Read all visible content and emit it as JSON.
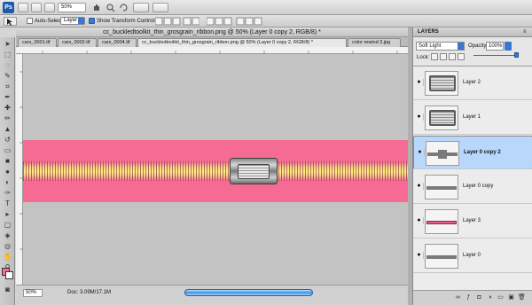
{
  "appbar": {
    "logo": "Ps",
    "zoom": "50%"
  },
  "options": {
    "auto_select_label": "Auto-Select:",
    "auto_select_target": "Layer",
    "show_transform_label": "Show Transform Controls"
  },
  "document": {
    "title": "cc_buckledtoolkit_thin_grosgrain_ribbon.png @ 50% (Layer 0 copy 2, RGB/8) *",
    "tabs": [
      {
        "label": "cars_0001.tif"
      },
      {
        "label": "cars_0002.tif"
      },
      {
        "label": "cars_0004.tif"
      },
      {
        "label": "cc_buckledtoolkit_thin_grosgrain_ribbon.png @ 50% (Layer 0 copy 2, RGB/8) *"
      },
      {
        "label": "color rewind 3.jpg"
      }
    ]
  },
  "status": {
    "zoom": "50%",
    "doc": "Doc: 3.09M/17.1M"
  },
  "layers_panel": {
    "title": "LAYERS",
    "blend_mode": "Soft Light",
    "opacity_label": "Opacity:",
    "opacity": "100%",
    "opacity_fraction": 1.0,
    "lock_label": "Lock:",
    "layers": [
      {
        "name": "Layer 2",
        "thumb": "buckle",
        "selected": false
      },
      {
        "name": "Layer 1",
        "thumb": "buckle",
        "selected": false
      },
      {
        "name": "Layer 0 copy 2",
        "thumb": "band-knot",
        "selected": true
      },
      {
        "name": "Layer 0 copy",
        "thumb": "band",
        "selected": false
      },
      {
        "name": "Layer 3",
        "thumb": "band-pink",
        "selected": false
      },
      {
        "name": "Layer 0",
        "thumb": "band",
        "selected": false
      }
    ]
  },
  "colors": {
    "ribbon": "#f56b93",
    "foreground_swatch": "#f56b9a",
    "background_swatch": "#ffffff",
    "selection": "#b9d7fb",
    "accent": "#3a78d0"
  }
}
